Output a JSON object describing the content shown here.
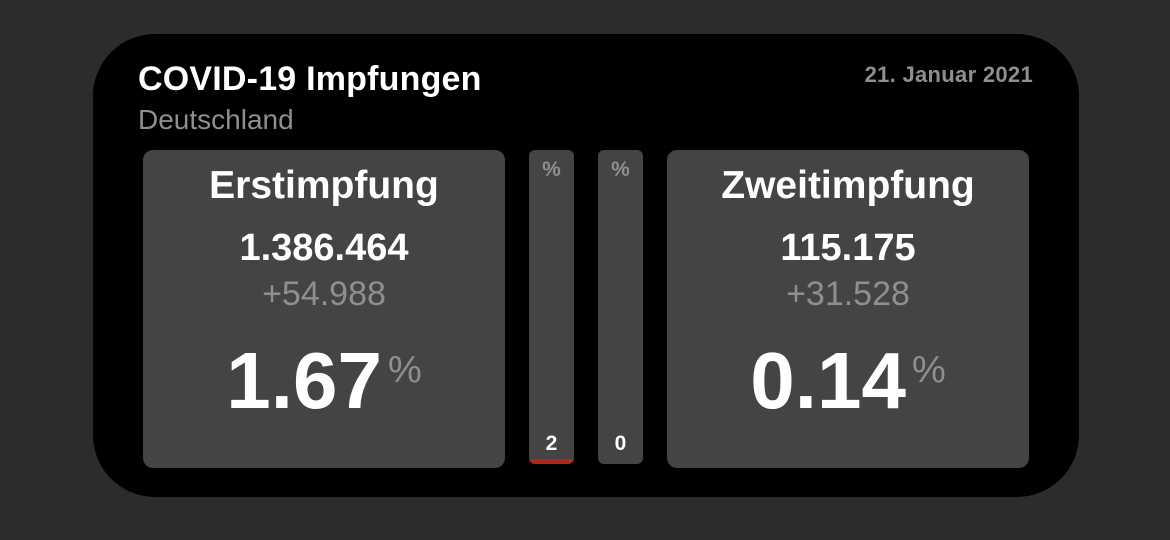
{
  "widget": {
    "title": "COVID-19 Impfungen",
    "subtitle": "Deutschland",
    "date": "21. Januar 2021"
  },
  "first_dose": {
    "heading": "Erstimpfung",
    "total": "1.386.464",
    "delta": "+54.988",
    "percent": "1.67",
    "percent_unit": "%"
  },
  "second_dose": {
    "heading": "Zweitimpfung",
    "total": "115.175",
    "delta": "+31.528",
    "percent": "0.14",
    "percent_unit": "%"
  },
  "bars": [
    {
      "symbol": "%",
      "label": "2",
      "fill_percent": 1.67,
      "fill_color": "#b3261e"
    },
    {
      "symbol": "%",
      "label": "0",
      "fill_percent": 0.14,
      "fill_color": "#b3261e"
    }
  ],
  "colors": {
    "background": "#2c2c2c",
    "widget": "#000000",
    "panel": "#444444",
    "primary_text": "#ffffff",
    "secondary_text": "#8e8e93",
    "accent": "#b3261e"
  }
}
